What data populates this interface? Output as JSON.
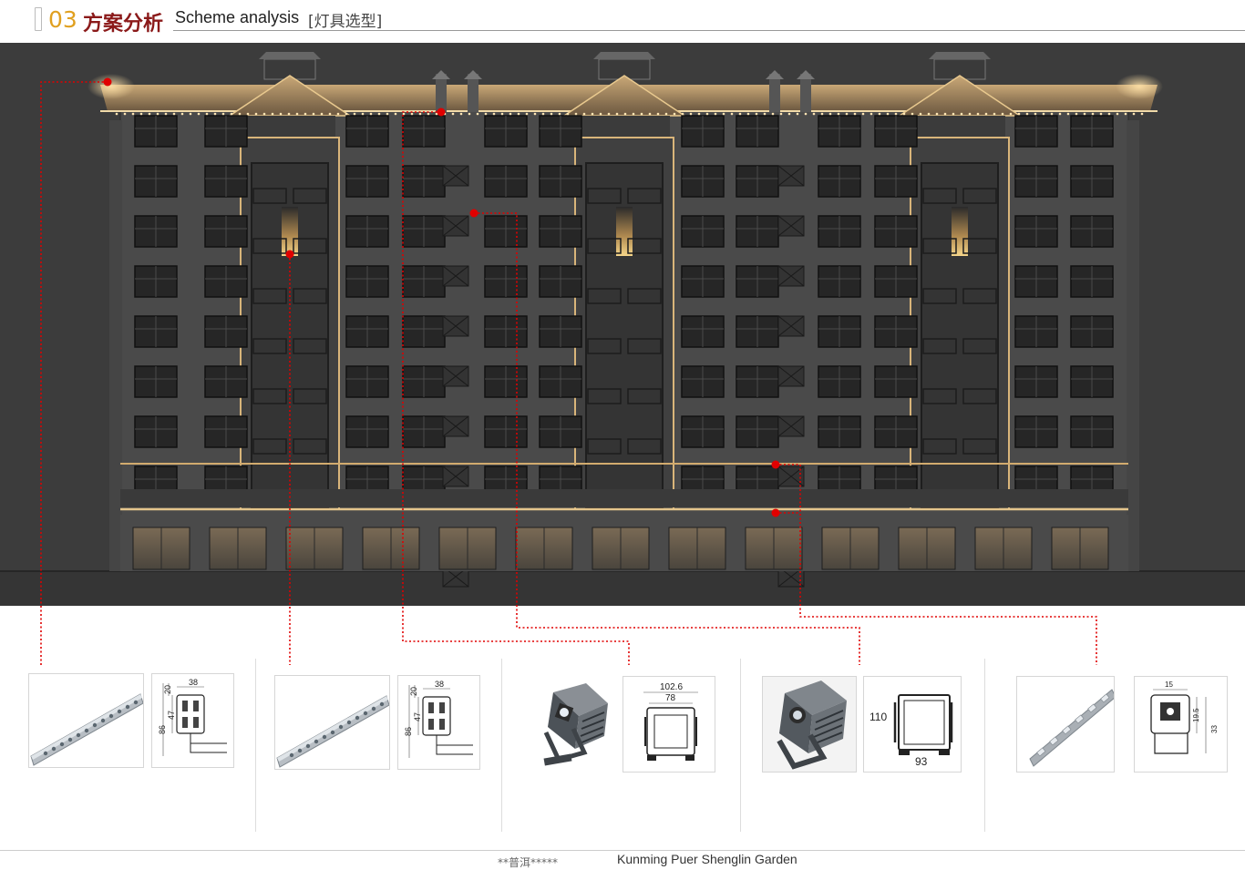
{
  "header": {
    "number": "03",
    "title_cn": "方案分析",
    "title_en": "Scheme analysis",
    "subtitle": "[灯具选型]"
  },
  "colors": {
    "accent_number": "#e0a020",
    "accent_title": "#8b1a1a",
    "leader_line": "#e00000",
    "scene_bg": "#3c3c3c",
    "facade": "#4a4a4a",
    "glow": "#e8c48a"
  },
  "fixtures": {
    "linear_a": {
      "dims": [
        "38",
        "20",
        "47",
        "86"
      ]
    },
    "linear_b": {
      "dims": [
        "38",
        "20",
        "47",
        "86"
      ]
    },
    "flood_small": {
      "dims": [
        "102.6",
        "78"
      ]
    },
    "flood_large": {
      "dims": [
        "110",
        "93"
      ]
    },
    "linear_slim": {
      "dims": [
        "15",
        "19.5",
        "33"
      ]
    }
  },
  "footer": {
    "left": "**普洱*****",
    "right": "Kunming Puer Shenglin Garden"
  }
}
